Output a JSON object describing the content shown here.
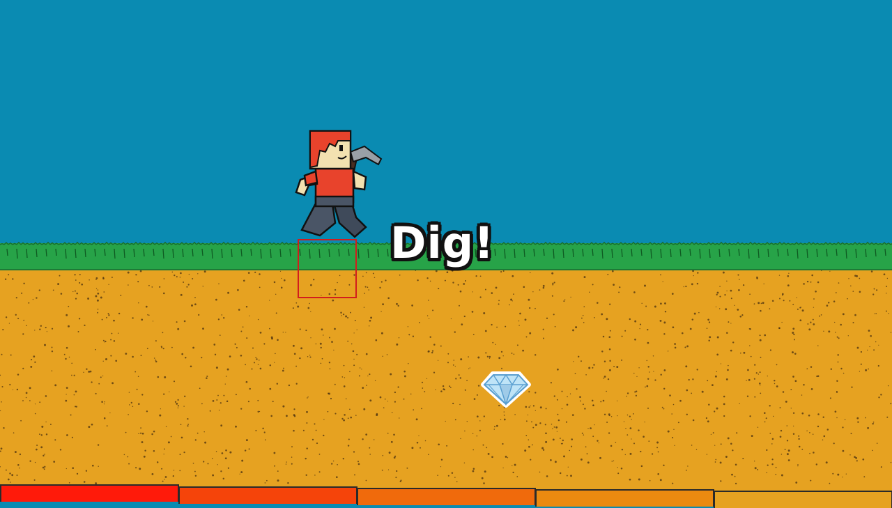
{
  "hud": {
    "prompt": "Dig!"
  },
  "scene": {
    "player": {
      "tool": "pickaxe-icon"
    },
    "buried_item": {
      "icon": "diamond-icon"
    }
  },
  "meter": {
    "segments": [
      {
        "color": "#ff1a0a"
      },
      {
        "color": "#f5440a"
      },
      {
        "color": "#f06a0c"
      },
      {
        "color": "#eb8a10"
      },
      {
        "color": "#e6a221"
      }
    ]
  },
  "colors": {
    "sky": "#0a8bb2",
    "grass": "#27a348",
    "dirt": "#e6a221",
    "target_outline": "#d21d1d"
  }
}
